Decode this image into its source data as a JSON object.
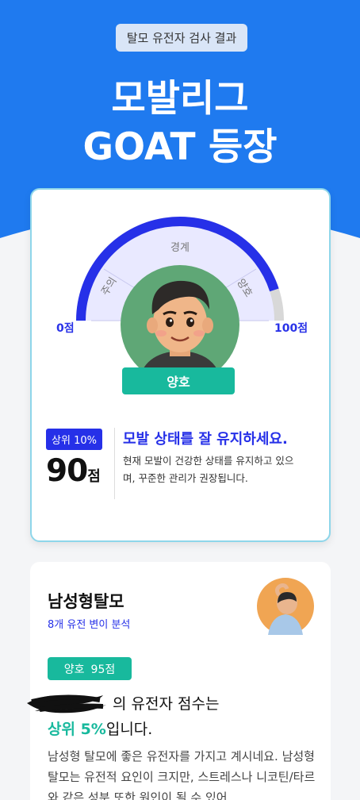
{
  "header": {
    "pill": "탈모 유전자 검사 결과",
    "title_line1": "모발리그",
    "title_line2": "GOAT 등장"
  },
  "gauge": {
    "labels": {
      "warning": "주의",
      "caution": "경계",
      "good": "양호"
    },
    "min_label": "0점",
    "max_label": "100점",
    "status": "양호",
    "score_fraction": 0.9
  },
  "result": {
    "rank_badge": "상위 10%",
    "score": "90",
    "score_unit": "점",
    "headline": "모발 상태를 잘 유지하세요.",
    "description": "현재 모발이 건강한 상태를 유지하고 있으며, 꾸준한 관리가 권장됩니다."
  },
  "detail_card": {
    "title": "남성형탈모",
    "subtitle": "8개 유전 변이 분석",
    "badge_status": "양호",
    "badge_score": "95점",
    "line1_suffix": "의 유전자 점수는",
    "line2_highlight": "상위 5%",
    "line2_suffix": "입니다.",
    "body": "남성형 탈모에 좋은 유전자를 가지고 계시네요. 남성형 탈모는 유전적 요인이 크지만, 스트레스나 니코틴/타르와 같은 성분 또한 원인이 될 수 있어"
  },
  "colors": {
    "brand_blue": "#1f7aef",
    "gauge_blue": "#2630e8",
    "teal": "#18b99d",
    "card_border": "#8ed6ea"
  }
}
